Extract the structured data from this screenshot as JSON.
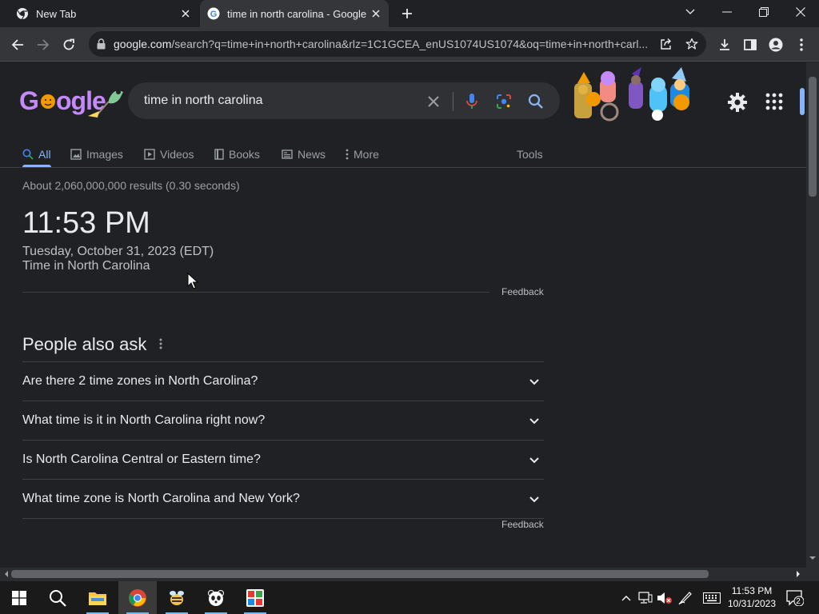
{
  "browser": {
    "tabs": [
      {
        "title": "New Tab"
      },
      {
        "title": "time in north carolina - Google S"
      }
    ],
    "url_domain": "google.com",
    "url_rest": "/search?q=time+in+north+carolina&rlz=1C1GCEA_enUS1074US1074&oq=time+in+north+carl..."
  },
  "search": {
    "logo": "Google",
    "query": "time in north carolina",
    "tabs": [
      {
        "label": "All"
      },
      {
        "label": "Images"
      },
      {
        "label": "Videos"
      },
      {
        "label": "Books"
      },
      {
        "label": "News"
      },
      {
        "label": "More"
      }
    ],
    "tools_label": "Tools",
    "stats": "About 2,060,000,000 results (0.30 seconds)"
  },
  "time_card": {
    "time": "11:53 PM",
    "date": "Tuesday, October 31, 2023 (EDT)",
    "place": "Time in North Carolina",
    "feedback": "Feedback"
  },
  "people_also_ask": {
    "title": "People also ask",
    "questions": [
      "Are there 2 time zones in North Carolina?",
      "What time is it in North Carolina right now?",
      "Is North Carolina Central or Eastern time?",
      "What time zone is North Carolina and New York?"
    ],
    "feedback": "Feedback"
  },
  "taskbar": {
    "time": "11:53 PM",
    "date": "10/31/2023",
    "notification_count": "2"
  },
  "colors": {
    "accent": "#8ab4f8",
    "background": "#202124",
    "toolbar": "#35363a"
  }
}
